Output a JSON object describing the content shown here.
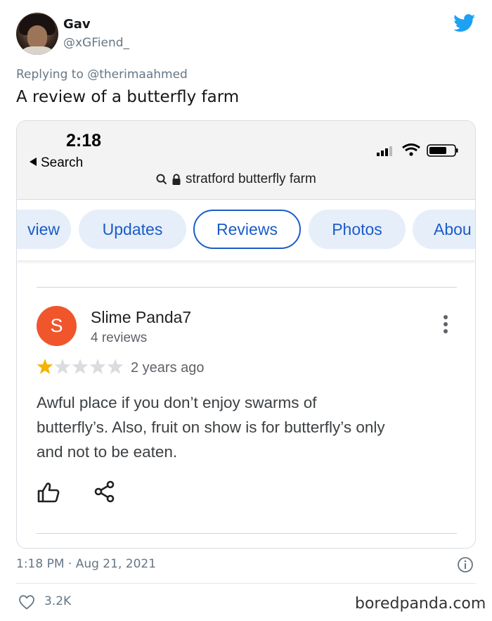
{
  "tweet": {
    "author_name": "Gav",
    "author_handle": "@xGFiend_",
    "reply_to": "Replying to @therimaahmed",
    "text": "A review of a butterfly farm",
    "timestamp": "1:18 PM · Aug 21, 2021",
    "like_count": "3.2K",
    "brand_color": "#1DA1F2",
    "icons": [
      "twitter-bird-icon",
      "info-icon",
      "heart-icon"
    ]
  },
  "screenshot": {
    "status_time": "2:18",
    "back_label": "Search",
    "url": "stratford butterfly farm",
    "tabs": [
      {
        "label": "view",
        "active": false
      },
      {
        "label": "Updates",
        "active": false
      },
      {
        "label": "Reviews",
        "active": true
      },
      {
        "label": "Photos",
        "active": false
      },
      {
        "label": "Abou",
        "active": false
      }
    ],
    "accent_color": "#1a5cc8",
    "review": {
      "avatar_letter": "S",
      "avatar_color": "#f0552c",
      "reviewer": "Slime Panda7",
      "review_count": "4 reviews",
      "rating": 1,
      "max_rating": 5,
      "time_ago": "2 years ago",
      "text_lines": [
        "Awful place if you don’t enjoy swarms of",
        "butterfly’s. Also, fruit on show is for butterfly’s only",
        "and not to be eaten."
      ]
    }
  },
  "watermark": "boredpanda.com"
}
